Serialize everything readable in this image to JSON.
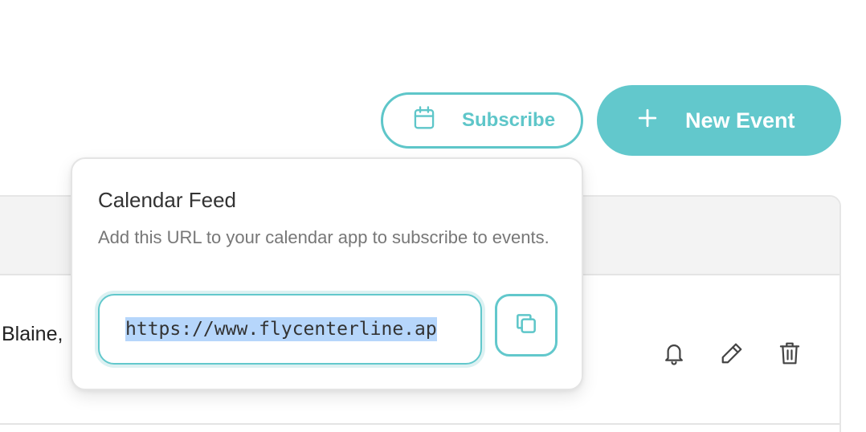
{
  "toolbar": {
    "subscribe_label": "Subscribe",
    "new_event_label": "New Event"
  },
  "table": {
    "rows": [
      {
        "name": "Blaine,",
        "actions": [
          "bell-icon",
          "pencil-icon",
          "trash-icon"
        ]
      }
    ]
  },
  "popover": {
    "title": "Calendar Feed",
    "description": "Add this URL to your calendar app to subscribe to events.",
    "url_value": "https://www.flycenterline.ap",
    "copy_icon": "copy-icon"
  },
  "colors": {
    "accent": "#62c8cc",
    "accent_light": "#dcf1f2",
    "selection": "#b6d6fb",
    "text_dark": "#333333",
    "text_muted": "#777777",
    "border": "#e4e4e4"
  }
}
